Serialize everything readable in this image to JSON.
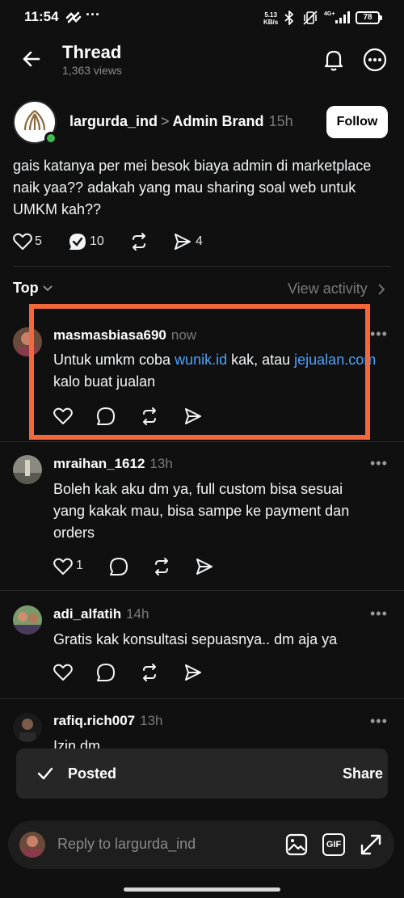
{
  "status_bar": {
    "time": "11:54",
    "net_speed_value": "5.13",
    "net_speed_unit": "KB/s",
    "network": "4G+",
    "battery": "78"
  },
  "header": {
    "title": "Thread",
    "views": "1,363 views"
  },
  "post": {
    "username": "largurda_ind",
    "separator": ">",
    "tag": "Admin Brand",
    "time": "15h",
    "follow_label": "Follow",
    "body": "gais katanya per mei besok biaya admin di marketplace naik yaa?? adakah yang mau sharing soal web untuk UMKM kah??",
    "likes": "5",
    "replies": "10",
    "reposts": "",
    "shares": "4"
  },
  "sort": {
    "label": "Top",
    "view_activity": "View activity"
  },
  "replies": [
    {
      "username": "masmasbiasa690",
      "time": "now",
      "text_before": "Untuk umkm coba ",
      "link1": "wunik.id",
      "text_mid": " kak, atau ",
      "link2": "jejualan.com",
      "text_after": " kalo buat jualan",
      "likes": ""
    },
    {
      "username": "mraihan_1612",
      "time": "13h",
      "text": "Boleh kak aku dm ya, full custom bisa sesuai yang kakak mau, bisa sampe ke payment dan orders",
      "likes": "1"
    },
    {
      "username": "adi_alfatih",
      "time": "14h",
      "text": "Gratis kak konsultasi sepuasnya.. dm aja ya",
      "likes": ""
    },
    {
      "username": "rafiq.rich007",
      "time": "13h",
      "text": "Izin dm",
      "likes": ""
    }
  ],
  "toast": {
    "label": "Posted",
    "action": "Share"
  },
  "reply_bar": {
    "placeholder": "Reply to largurda_ind",
    "gif_label": "GIF"
  },
  "colors": {
    "background": "#101010",
    "link": "#4aa3ff",
    "highlight": "#f2683a",
    "online": "#3fbe4f"
  }
}
